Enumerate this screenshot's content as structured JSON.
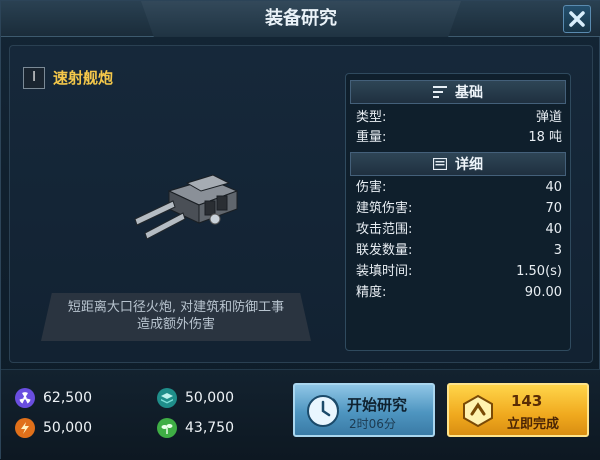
{
  "window": {
    "title": "装备研究"
  },
  "item": {
    "tier": "I",
    "name": "速射舰炮",
    "description_line1": "短距离大口径火炮, 对建筑和防御工事",
    "description_line2": "造成额外伤害"
  },
  "basics": {
    "header": "基础",
    "rows": [
      {
        "label": "类型:",
        "value": "弹道"
      },
      {
        "label": "重量:",
        "value": "18 吨"
      }
    ]
  },
  "details": {
    "header": "详细",
    "rows": [
      {
        "label": "伤害:",
        "value": "40"
      },
      {
        "label": "建筑伤害:",
        "value": "70"
      },
      {
        "label": "攻击范围:",
        "value": "40"
      },
      {
        "label": "联发数量:",
        "value": "3"
      },
      {
        "label": "装填时间:",
        "value": "1.50(s)"
      },
      {
        "label": "精度:",
        "value": "90.00"
      }
    ]
  },
  "resources": [
    {
      "icon": "radiation-icon",
      "value": "62,500",
      "color": "#7a5cff"
    },
    {
      "icon": "layers-icon",
      "value": "50,000",
      "color": "#28b2a8"
    },
    {
      "icon": "energy-icon",
      "value": "50,000",
      "color": "#ff8a1e"
    },
    {
      "icon": "plant-icon",
      "value": "43,750",
      "color": "#58d05a"
    }
  ],
  "actions": {
    "research_label": "开始研究",
    "research_time": "2时06分",
    "instant_cost": "143",
    "instant_label": "立即完成"
  }
}
